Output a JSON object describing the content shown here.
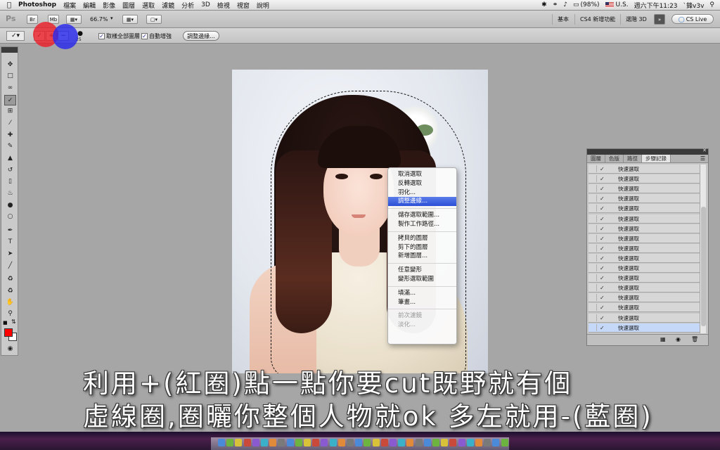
{
  "menubar": {
    "app": "Photoshop",
    "menus": [
      "檔案",
      "編輯",
      "影像",
      "圖層",
      "選取",
      "濾鏡",
      "分析",
      "3D",
      "檢視",
      "視窗",
      "說明"
    ],
    "battery": "(98%)",
    "locale": "U.S.",
    "clock": "週六下午11:23",
    "user": "`鋒v3v"
  },
  "appbar": {
    "logo": "Ps",
    "bridge": "Br",
    "minibridge": "Mb",
    "zoom": "66.7%",
    "workspaces": [
      "基本",
      "CS4 新增功能",
      "選階 3D"
    ],
    "cslive": "CS Live"
  },
  "options": {
    "brush_size": "25",
    "sample_all_layers": "取樣全部圖層",
    "auto_enhance": "自動增強",
    "refine_edge": "調整邊緣..."
  },
  "context_menu": {
    "groups": [
      [
        "取消選取",
        "反轉選取",
        "羽化...",
        "調整邊緣..."
      ],
      [
        "儲存選取範圍...",
        "製作工作路徑..."
      ],
      [
        "拷貝的圖層",
        "剪下的圖層",
        "新增圖層..."
      ],
      [
        "任意變形",
        "變形選取範圍"
      ],
      [
        "填滿...",
        "筆畫..."
      ],
      [
        "前次濾鏡",
        "淡化..."
      ]
    ],
    "highlighted": "調整邊緣...",
    "disabled": [
      "前次濾鏡",
      "淡化..."
    ]
  },
  "history_panel": {
    "tabs": [
      "圖層",
      "色版",
      "路徑",
      "步驟記錄"
    ],
    "active_tab": "步驟記錄",
    "items": [
      "快速選取",
      "快速選取",
      "快速選取",
      "快速選取",
      "快速選取",
      "快速選取",
      "快速選取",
      "快速選取",
      "快速選取",
      "快速選取",
      "快速選取",
      "快速選取",
      "快速選取",
      "快速選取",
      "快速選取",
      "快速選取",
      "快速選取"
    ],
    "selected_index": 16
  },
  "colors": {
    "foreground": "#ff0000",
    "background": "#ffffff"
  },
  "caption": {
    "line1": "利用+(紅圈)點一點你要cut既野就有個",
    "line2": "虛線圈,圈曬你整個人物就ok 多左就用-(藍圈)"
  }
}
